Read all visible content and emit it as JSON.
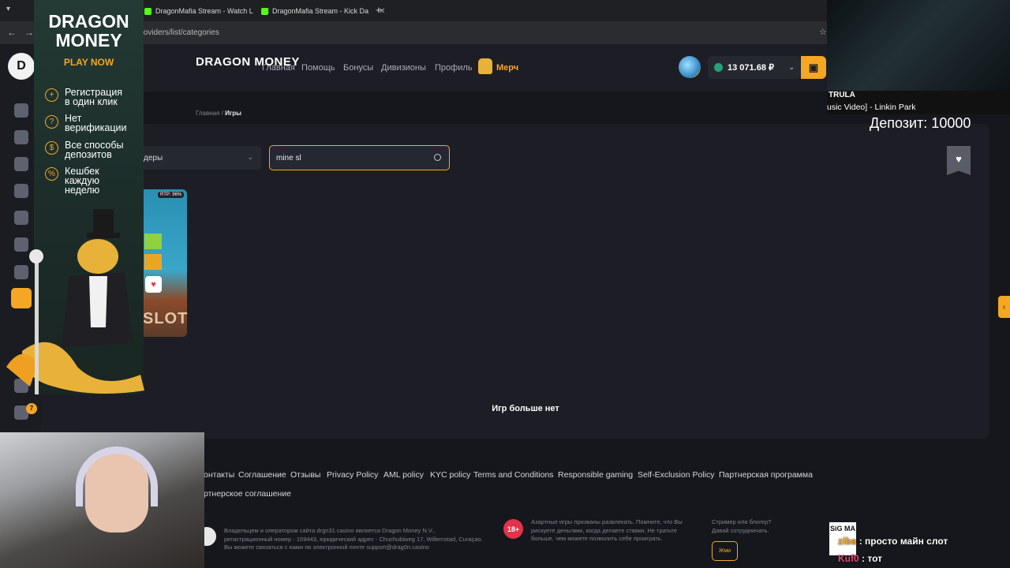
{
  "browser": {
    "tabs": [
      {
        "label": "DragonMafia Stream - Watch L"
      },
      {
        "label": "DragonMafia Stream - Kick Da"
      }
    ],
    "new_tab": "+",
    "url": "/providers/list/categories"
  },
  "header": {
    "brand": "DRAGON MONEY",
    "nav": [
      "Главная",
      "Помощь",
      "Бонусы",
      "Дивизионы",
      "Профиль"
    ],
    "merch": "Мерч",
    "balance": "13 071.68 ₽",
    "colors": {
      "accent": "#f5a623",
      "balance_coin": "#26a17b"
    }
  },
  "breadcrumb": {
    "home": "Главная",
    "sep": "/",
    "current": "Игры"
  },
  "filters": {
    "provider_value": "деры",
    "search_value": "mine sl"
  },
  "game": {
    "rtp": "RTP: 96%",
    "label": "SLOT"
  },
  "empty_message": "Игр больше нет",
  "footer": {
    "links": [
      "онтакты",
      "Соглашение",
      "Отзывы",
      "Privacy Policy",
      "AML policy",
      "KYC policy",
      "Terms and Conditions",
      "Responsible gaming",
      "Self-Exclusion Policy",
      "Партнерская программа"
    ],
    "link2": "ртнерское соглашение",
    "legal": [
      "Владельцем и оператором сайта drgn31.casino является Dragon Money N.V.,",
      "регистрационный номер - 159443, юридический адрес - Chuchubiweg 17, Willemstad, Curaçao.",
      "Вы можете связаться с нами по электронной почте support@drag0n.casino"
    ],
    "age_badge": "18+",
    "gamble_note": [
      "Азартные игры призваны развлекать. Помните, что Вы",
      "рискуете деньгами, когда делаете ставки. Не тратьте",
      "больше, чем можете позволить себе проиграть."
    ],
    "streamer_note": [
      "Стример или блогер?",
      "Давай сотрудничать."
    ],
    "write_button": "Жми"
  },
  "ad": {
    "title_line1": "DRAGON",
    "title_line2": "MONEY",
    "cta": "PLAY NOW",
    "features": [
      {
        "icon": "plus-icon",
        "line1": "Регистрация",
        "line2": "в один клик"
      },
      {
        "icon": "question-icon",
        "line1": "Нет",
        "line2": "верификации"
      },
      {
        "icon": "coin-icon",
        "line1": "Все способы",
        "line2": "депозитов"
      },
      {
        "icon": "percent-icon",
        "line1": "Кешбек",
        "line2": "каждую"
      }
    ],
    "features_extra": "неделю"
  },
  "stream": {
    "music_title": "TRULA",
    "music_sub": "usic Video] - Linkin Park",
    "deposit": "Депозит: 10000",
    "sigma": "SiG MA",
    "chat": [
      {
        "nick": "ziba",
        "text": ": просто майн слот"
      },
      {
        "nick": "Kuf0",
        "text": ": тот"
      }
    ],
    "rail_badge": "7"
  }
}
